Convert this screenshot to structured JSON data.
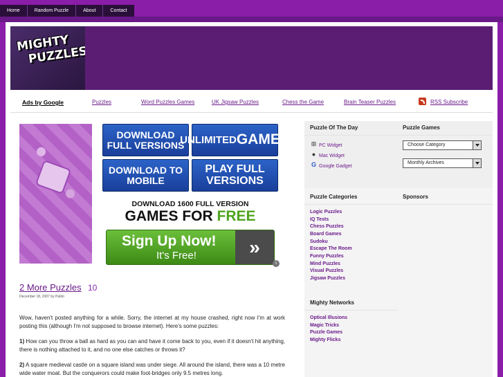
{
  "nav": {
    "tabs": [
      "Home",
      "Random Puzzle",
      "About",
      "Contact"
    ]
  },
  "logo": {
    "line1": "MIGHTY",
    "line2": "PUZZLES"
  },
  "linkbar": {
    "ads_label": "Ads by Google",
    "links": [
      "Puzzles",
      "Word Puzzles Games",
      "UK Jigsaw Puzzles",
      "Chess the Game",
      "Brain Teaser Puzzles"
    ],
    "rss_label": "RSS Subscribe"
  },
  "ad": {
    "btn1": "DOWNLOAD FULL VERSIONS",
    "btn2_small": "UNLIMITED",
    "btn2_big": "GAMES",
    "btn3": "DOWNLOAD TO MOBILE",
    "btn4": "PLAY FULL VERSIONS",
    "line1": "DOWNLOAD 1600 FULL VERSION",
    "line2_prefix": "GAMES FOR ",
    "line2_free": "FREE",
    "signup": "Sign Up Now!",
    "signup_sub": "It's Free!",
    "arrows": "»"
  },
  "post": {
    "title": "2 More Puzzles",
    "comments": "10",
    "meta": "December 18, 2007 by Pablo",
    "intro": "Wow, haven't posted anything for a while. Sorry, the internet at my house crashed, right now I'm at work posting this (although I'm not supposed to browse internet). Here's some puzzles:",
    "q1_num": "1)",
    "q1": " How can you throw a ball as hard as you can and have it come back to you, even if it doesn't hit anything, there is nothing attached to it, and no one else catches or throws it?",
    "q2_num": "2)",
    "q2": " A square medieval castle on a square island was under siege. All around the island, there was a 10 metre wide water moat. But the conquerors could make foot-bridges only 9.5 metres long."
  },
  "sidebar": {
    "puzzle_of_day_title": "Puzzle Of The Day",
    "widgets": [
      "PC Widget",
      "Mac Widget",
      "Google Gadget"
    ],
    "puzzle_games_title": "Puzzle Games",
    "select_category": "Choose Category",
    "select_archive": "Monthly Archives",
    "categories_title": "Puzzle Categories",
    "categories": [
      "Logic Puzzles",
      "IQ Tests",
      "Chess Puzzles",
      "Board Games",
      "Sudoku",
      "Escape The Room",
      "Funny Puzzles",
      "Mind Puzzles",
      "Visual Puzzles",
      "Jigsaw Puzzles"
    ],
    "sponsors_title": "Sponsors",
    "networks_title": "Mighty Networks",
    "networks": [
      "Optical Illusions",
      "Magic Tricks",
      "Puzzle Games",
      "Mighty Flicks"
    ]
  }
}
